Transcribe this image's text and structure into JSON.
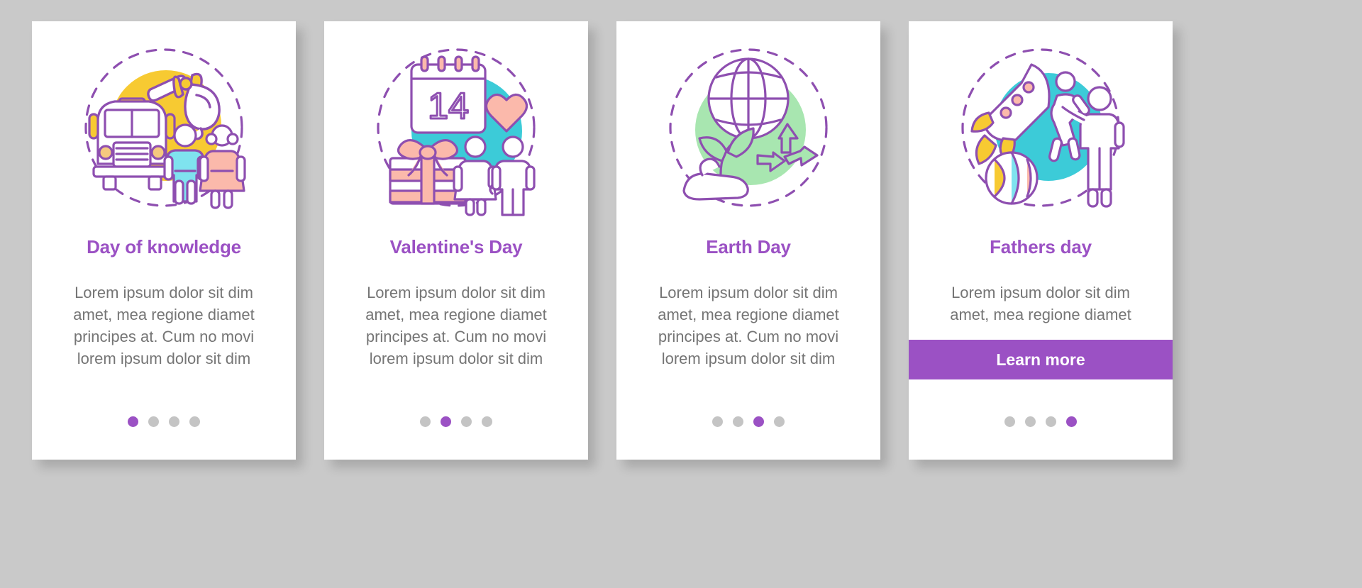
{
  "theme": {
    "page_background": "#c9c9c9",
    "card_background": "#ffffff",
    "accent": "#9b51c4",
    "body_text": "#757575",
    "dot_inactive": "#c4c4c4",
    "blob_yellow": "#f7ca32",
    "blob_cyan": "#3ccbd8",
    "blob_green": "#a8e6b0",
    "pink": "#fbb9ab",
    "cyan_light": "#7fe3ef"
  },
  "cards": [
    {
      "id": "day-of-knowledge",
      "illustration": "school-bus-bell-children-icon",
      "blob_color": "#f7ca32",
      "title": "Day of knowledge",
      "body_lines": [
        "Lorem ipsum dolor sit dim",
        "amet, mea regione diamet",
        "principes at. Cum no movi",
        "lorem ipsum dolor sit dim"
      ],
      "has_button": false,
      "button_label": "",
      "dots": {
        "count": 4,
        "active_index": 0
      }
    },
    {
      "id": "valentines-day",
      "illustration": "calendar-gift-heart-couple-icon",
      "blob_color": "#3ccbd8",
      "calendar_date": "14",
      "title": "Valentine's Day",
      "body_lines": [
        "Lorem ipsum dolor sit dim",
        "amet, mea regione diamet",
        "principes at. Cum no movi",
        "lorem ipsum dolor sit dim"
      ],
      "has_button": false,
      "button_label": "",
      "dots": {
        "count": 4,
        "active_index": 1
      }
    },
    {
      "id": "earth-day",
      "illustration": "globe-plant-hand-recycle-icon",
      "blob_color": "#a8e6b0",
      "title": "Earth Day",
      "body_lines": [
        "Lorem ipsum dolor sit dim",
        "amet, mea regione diamet",
        "principes at. Cum no movi",
        "lorem ipsum dolor sit dim"
      ],
      "has_button": false,
      "button_label": "",
      "dots": {
        "count": 4,
        "active_index": 2
      }
    },
    {
      "id": "fathers-day",
      "illustration": "rocket-ball-father-child-icon",
      "blob_color": "#3ccbd8",
      "title": "Fathers day",
      "body_lines": [
        "Lorem ipsum dolor sit dim",
        "amet, mea regione diamet"
      ],
      "has_button": true,
      "button_label": "Learn more",
      "dots": {
        "count": 4,
        "active_index": 3
      }
    }
  ]
}
